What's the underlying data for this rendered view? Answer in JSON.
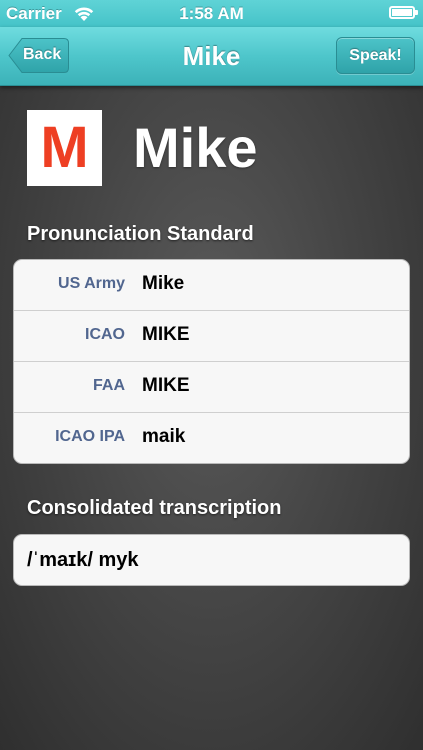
{
  "status_bar": {
    "carrier": "Carrier",
    "time": "1:58 AM",
    "wifi_icon": "wifi-icon",
    "battery_icon": "battery-icon"
  },
  "nav": {
    "title": "Mike",
    "back_label": "Back",
    "speak_label": "Speak!"
  },
  "header": {
    "letter": "M",
    "word": "Mike",
    "letter_color": "#ee3f23"
  },
  "pronunciation": {
    "section_title": "Pronunciation Standard",
    "rows": [
      {
        "key": "US Army",
        "value": "Mike"
      },
      {
        "key": "ICAO",
        "value": "MIKE"
      },
      {
        "key": "FAA",
        "value": "MIKE"
      },
      {
        "key": "ICAO IPA",
        "value": "maik"
      }
    ]
  },
  "consolidated": {
    "section_title": "Consolidated transcription",
    "value": "/ˈmaɪk/ myk"
  },
  "colors": {
    "accent": "#4ec6cb",
    "label_blue": "#51668f"
  }
}
